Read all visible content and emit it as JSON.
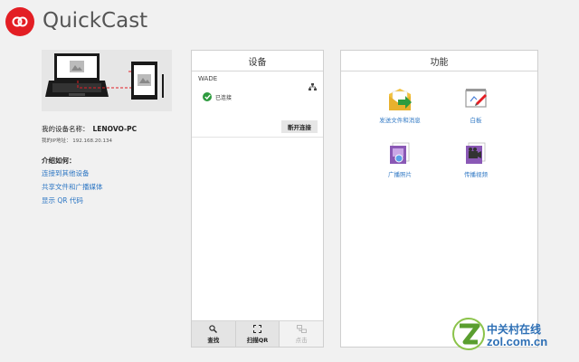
{
  "app": {
    "title": "QuickCast"
  },
  "left": {
    "device_name_label": "我的设备名称：",
    "device_name_value": "LENOVO-PC",
    "ip_label": "我的IP地址：",
    "ip_value": "192.168.20.134",
    "howto_title": "介绍如何：",
    "links": [
      "连接到其他设备",
      "共享文件和广播媒体",
      "显示 QR 代码"
    ]
  },
  "devices_panel": {
    "title": "设备",
    "device": {
      "name": "WADE",
      "status": "已连接",
      "net_icon": "network-icon"
    },
    "disconnect_label": "断开连接",
    "toolbar": [
      {
        "label": "查找",
        "icon": "search-icon",
        "enabled": true
      },
      {
        "label": "扫描QR",
        "icon": "qr-scan-icon",
        "enabled": true
      },
      {
        "label": "点击",
        "icon": "tap-icon",
        "enabled": false
      }
    ]
  },
  "features_panel": {
    "title": "功能",
    "items": [
      {
        "label": "发送文件和消息",
        "icon": "send-files-icon"
      },
      {
        "label": "白板",
        "icon": "whiteboard-icon"
      },
      {
        "label": "广播照片",
        "icon": "broadcast-photo-icon"
      },
      {
        "label": "传播视频",
        "icon": "broadcast-video-icon"
      }
    ]
  },
  "watermark": {
    "line1": "中关村在线",
    "line2": "zol.com.cn"
  },
  "colors": {
    "brand": "#e31e24",
    "link": "#2e77c4",
    "connected": "#2e9b3f"
  }
}
